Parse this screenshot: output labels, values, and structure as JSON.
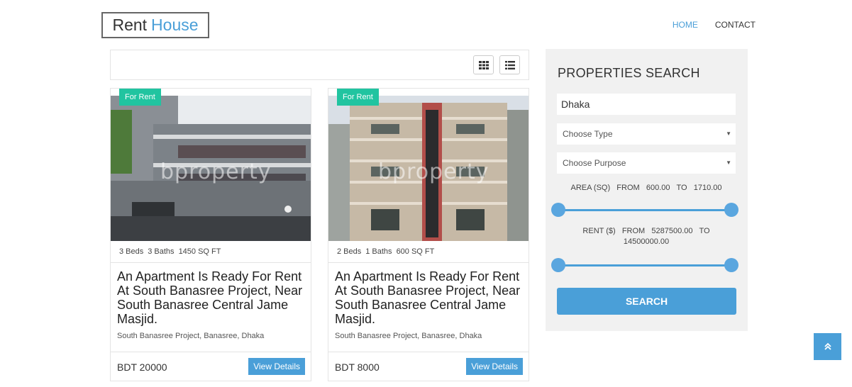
{
  "header": {
    "logo_part1": "Rent",
    "logo_part2": "House",
    "nav": [
      {
        "label": "HOME"
      },
      {
        "label": "CONTACT"
      }
    ]
  },
  "listings": [
    {
      "badge": "For Rent",
      "watermark": "bproperty",
      "beds": "3 Beds",
      "baths": "3 Baths",
      "area": "1450 SQ FT",
      "title": "An Apartment Is Ready For Rent At South Banasree Project, Near South Banasree Central Jame Masjid.",
      "address": "South Banasree Project, Banasree, Dhaka",
      "price": "BDT 20000",
      "button": "View Details"
    },
    {
      "badge": "For Rent",
      "watermark": "bproperty",
      "beds": "2 Beds",
      "baths": "1 Baths",
      "area": "600 SQ FT",
      "title": "An Apartment Is Ready For Rent At South Banasree Project, Near South Banasree Central Jame Masjid.",
      "address": "South Banasree Project, Banasree, Dhaka",
      "price": "BDT 8000",
      "button": "View Details"
    }
  ],
  "search": {
    "title": "PROPERTIES SEARCH",
    "location_value": "Dhaka",
    "type_value": "Choose Type",
    "purpose_value": "Choose Purpose",
    "area_label": "AREA (SQ)   FROM   600.00   TO   1710.00",
    "rent_label": "RENT ($)   FROM   5287500.00   TO   14500000.00",
    "button": "SEARCH"
  },
  "colors": {
    "accent": "#4a9fd8",
    "badge": "#21c4a0",
    "panel_bg": "#f1f1f1"
  }
}
